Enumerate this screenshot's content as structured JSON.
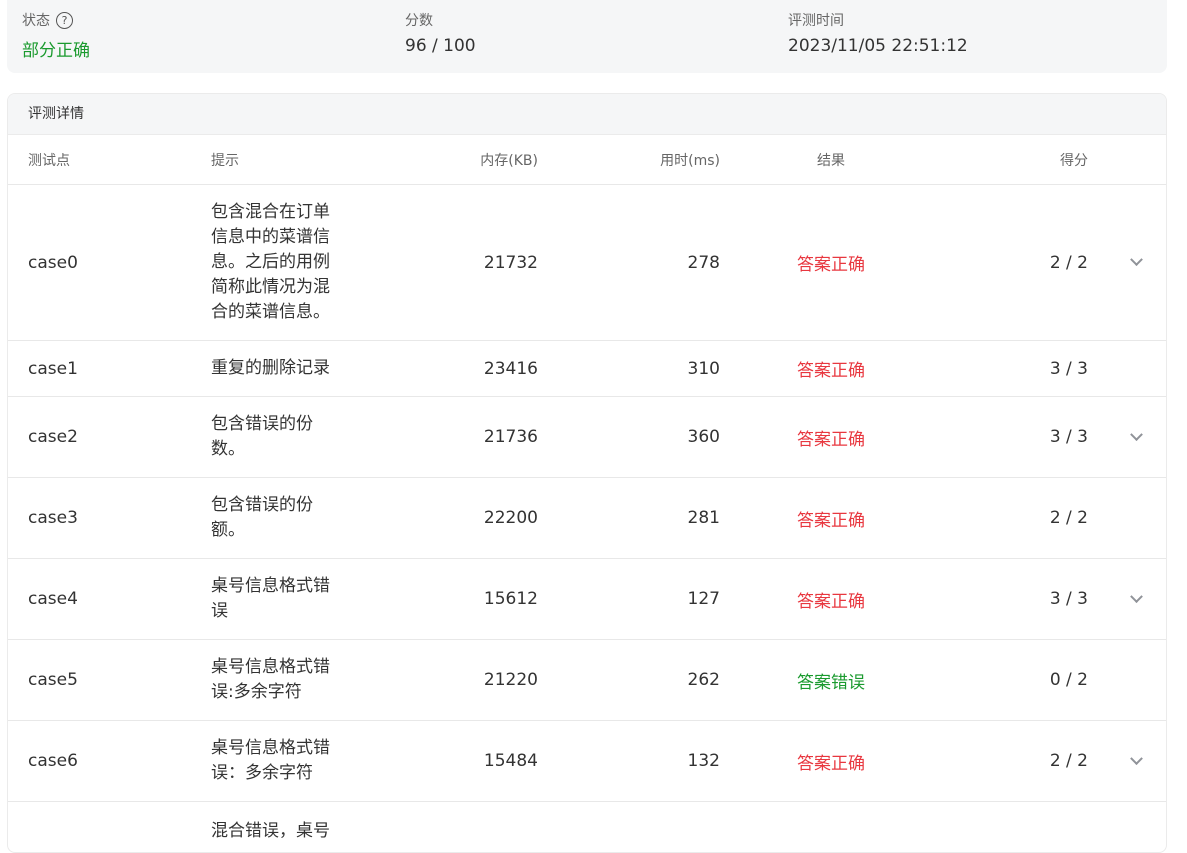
{
  "summary": {
    "status_label": "状态",
    "status_value": "部分正确",
    "score_label": "分数",
    "score_value": "96 / 100",
    "time_label": "评测时间",
    "time_value": "2023/11/05 22:51:12",
    "colors": {
      "status": "#1a9a2e"
    }
  },
  "detail": {
    "title": "评测详情",
    "columns": [
      "测试点",
      "提示",
      "内存(KB)",
      "用时(ms)",
      "结果",
      "得分"
    ],
    "rows": [
      {
        "case": "case0",
        "hint_lines": [
          "包含混合在订单",
          "信息中的菜谱信",
          "息。之后的用例",
          "简称此情况为混",
          "合的菜谱信息。"
        ],
        "memory": "21732",
        "time": "278",
        "result": "答案正确",
        "score": "2 / 2",
        "expandable": true
      },
      {
        "case": "case1",
        "hint_lines": [
          "重复的删除记录"
        ],
        "memory": "23416",
        "time": "310",
        "result": "答案正确",
        "score": "3 / 3",
        "expandable": false
      },
      {
        "case": "case2",
        "hint_lines": [
          "包含错误的份",
          "数。"
        ],
        "memory": "21736",
        "time": "360",
        "result": "答案正确",
        "score": "3 / 3",
        "expandable": true
      },
      {
        "case": "case3",
        "hint_lines": [
          "包含错误的份",
          "额。"
        ],
        "memory": "22200",
        "time": "281",
        "result": "答案正确",
        "score": "2 / 2",
        "expandable": false
      },
      {
        "case": "case4",
        "hint_lines": [
          "桌号信息格式错",
          "误"
        ],
        "memory": "15612",
        "time": "127",
        "result": "答案正确",
        "score": "3 / 3",
        "expandable": true
      },
      {
        "case": "case5",
        "hint_lines": [
          "桌号信息格式错",
          "误:多余字符"
        ],
        "memory": "21220",
        "time": "262",
        "result": "答案错误",
        "score": "0 / 2",
        "expandable": false
      },
      {
        "case": "case6",
        "hint_lines": [
          "桌号信息格式错",
          "误：多余字符"
        ],
        "memory": "15484",
        "time": "132",
        "result": "答案正确",
        "score": "2 / 2",
        "expandable": true
      },
      {
        "case": "",
        "hint_lines": [
          "混合错误，桌号"
        ],
        "memory": "",
        "time": "",
        "result": "",
        "score": "",
        "expandable": false
      }
    ],
    "colors": {
      "correct": "#e8373f",
      "wrong": "#1a9a2e"
    }
  },
  "icons": {
    "help": "help-circle-icon",
    "expand": "chevron-down-icon"
  }
}
